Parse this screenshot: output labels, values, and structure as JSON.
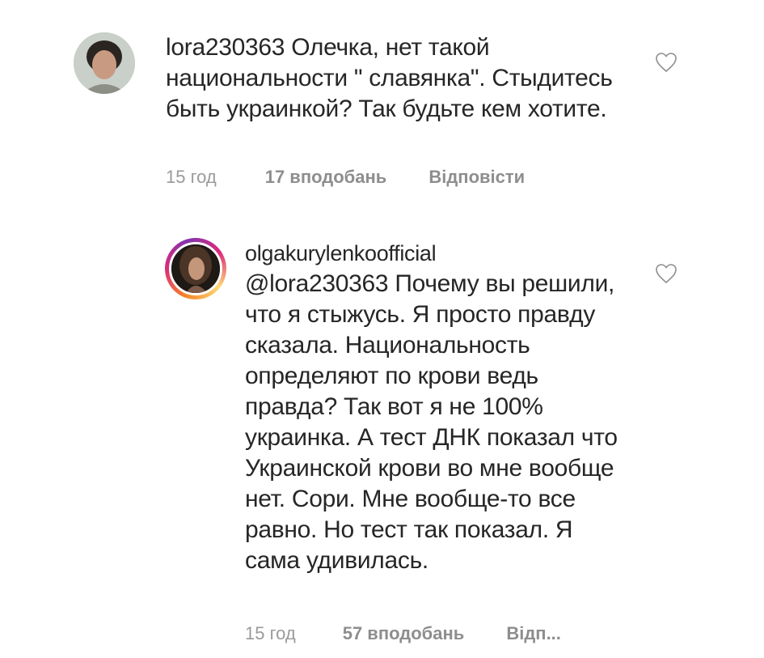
{
  "comments": [
    {
      "username": "lora230363",
      "text": "Олечка, нет такой национальности \" славянка\". Стыдитесь быть украинкой?  Так будьте кем хотите.",
      "time": "15 год",
      "likes": "17 вподобань",
      "reply": "Відповісти"
    },
    {
      "username": "olgakurylenkoofficial",
      "mention": "@lora230363",
      "text": "Почему вы решили, что я стыжусь. Я просто правду сказала. Национальность определяют по крови ведь правда? Так вот я не 100% украинка. А тест ДНК показал что Украинской крови во мне вообще нет. Сори. Мне вообще-то все равно. Но тест так показал. Я сама удивилась.",
      "time": "15 год",
      "likes": "57 вподобань",
      "reply": "Відп..."
    }
  ],
  "icons": {
    "like": "heart-outline-icon"
  }
}
